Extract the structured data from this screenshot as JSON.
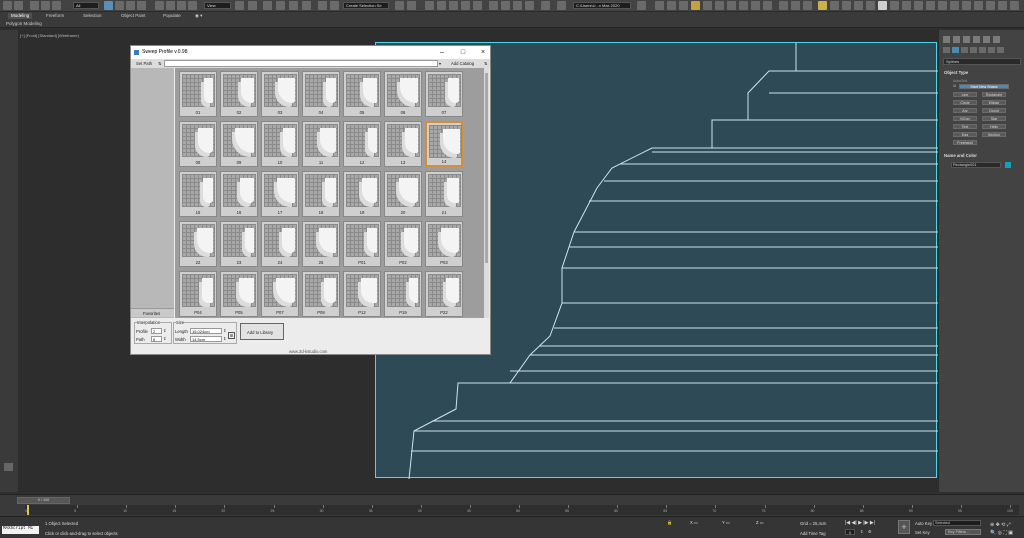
{
  "toolbar": {
    "layer_dropdown": "All",
    "view_dropdown": "View",
    "selection_set": "Create Selection Se",
    "workspace": "C:\\Users\\U...x Max 2020"
  },
  "ribbon": {
    "tabs": [
      "Modeling",
      "Freeform",
      "Selection",
      "Object Paint",
      "Populate"
    ],
    "sub_label": "Polygon Modeling"
  },
  "viewport": {
    "label": "[+] [Front] [Standard] [Wireframe]",
    "colors": {
      "background": "#2d4a56",
      "wire": "#cfe3ea",
      "active_border": "#4fd6e6"
    }
  },
  "dialog": {
    "title": "Sweep Profile v.0.98",
    "set_path": "Set Path",
    "add_catalog": "Add Catalog",
    "favorites": "Favorites",
    "items": [
      {
        "label": "01"
      },
      {
        "label": "02"
      },
      {
        "label": "03"
      },
      {
        "label": "04"
      },
      {
        "label": "05"
      },
      {
        "label": "06"
      },
      {
        "label": "07"
      },
      {
        "label": "08"
      },
      {
        "label": "09"
      },
      {
        "label": "10"
      },
      {
        "label": "11"
      },
      {
        "label": "12"
      },
      {
        "label": "13"
      },
      {
        "label": "14"
      },
      {
        "label": "15"
      },
      {
        "label": "16"
      },
      {
        "label": "17"
      },
      {
        "label": "18"
      },
      {
        "label": "19"
      },
      {
        "label": "20"
      },
      {
        "label": "21"
      },
      {
        "label": "22"
      },
      {
        "label": "23"
      },
      {
        "label": "24"
      },
      {
        "label": "25"
      },
      {
        "label": "P01"
      },
      {
        "label": "P02"
      },
      {
        "label": "P03"
      },
      {
        "label": "P04"
      },
      {
        "label": "P05"
      },
      {
        "label": "P07"
      },
      {
        "label": "P08"
      },
      {
        "label": "P12"
      },
      {
        "label": "P19"
      },
      {
        "label": "P22"
      }
    ],
    "selected_index": 13,
    "interpolation_label": "Interpolation",
    "profile_label": "Profile",
    "profile_value": "2",
    "path_label": "Path",
    "path_value": "6",
    "size_label": "Size",
    "length_label": "Length",
    "length_value": "15,024cm",
    "width_label": "Width",
    "width_value": "14,5cm",
    "add_library": "Add to Library",
    "footer": "www.3d-kstudio.com",
    "accent": "#d28f3c"
  },
  "command_panel": {
    "category": "Splines",
    "object_type_head": "Object Type",
    "autogrid_label": "AutoGrid",
    "start_new_shape": "Start New Shape",
    "buttons": [
      "Line",
      "Rectangle",
      "Circle",
      "Ellipse",
      "Arc",
      "Donut",
      "NGon",
      "Star",
      "Text",
      "Helix",
      "Egg",
      "Section",
      "Freehand"
    ],
    "name_color_head": "Name and Color",
    "object_name": "Rectangle001",
    "object_color": "#0aa5b8"
  },
  "timeline": {
    "frame": "0 / 100",
    "ticks": [
      "0",
      "5",
      "10",
      "15",
      "20",
      "25",
      "30",
      "35",
      "40",
      "45",
      "50",
      "55",
      "60",
      "65",
      "70",
      "75",
      "80",
      "85",
      "90",
      "95",
      "100"
    ]
  },
  "status": {
    "listener": "MAXScript Mi",
    "selected": "1 Object Selected",
    "prompt": "Click or click-and-drag to select objects",
    "grid": "Grid = 25,4cm",
    "add_time_tag": "Add Time Tag",
    "auto_key": "Auto Key",
    "set_key": "Set Key",
    "key_mode": "Selected",
    "key_filters": "Key Filters...",
    "frame": "0"
  }
}
